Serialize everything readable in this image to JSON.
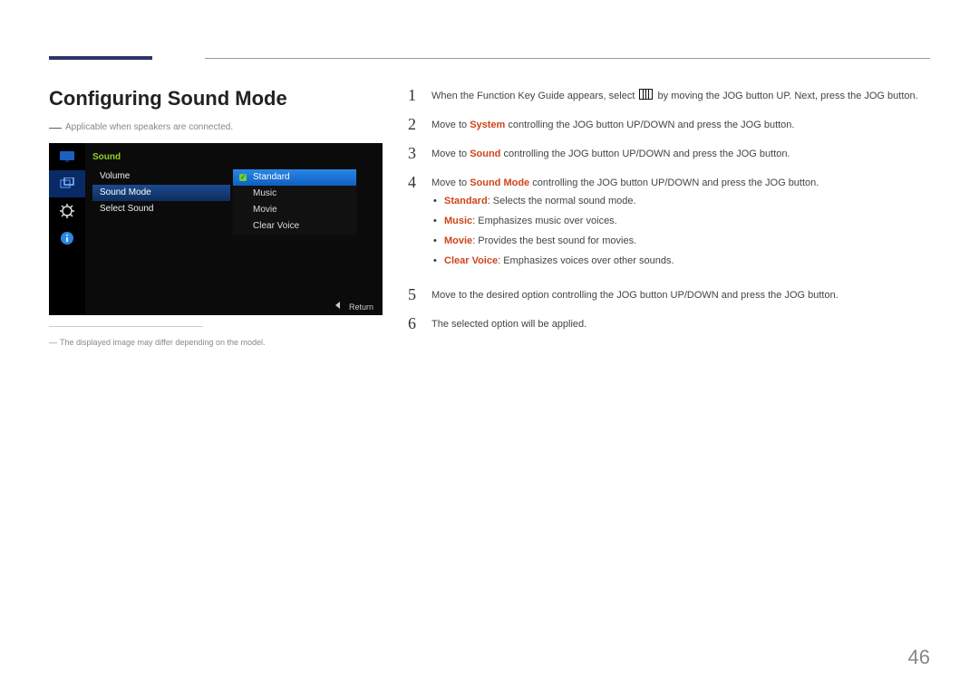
{
  "page": {
    "number": "46"
  },
  "heading": "Configuring Sound Mode",
  "subnote": "Applicable when speakers are connected.",
  "footnote": "The displayed image may differ depending on the model.",
  "osd": {
    "title": "Sound",
    "menu": [
      "Volume",
      "Sound Mode",
      "Select Sound"
    ],
    "selected_menu_index": 1,
    "submenu": [
      "Standard",
      "Music",
      "Movie",
      "Clear Voice"
    ],
    "selected_sub_index": 0,
    "return_label": "Return"
  },
  "instructions": {
    "steps": [
      {
        "n": "1",
        "pre": "When the Function Key Guide appears, select ",
        "post": " by moving the JOG button UP. Next, press the JOG button.",
        "icon": true
      },
      {
        "n": "2",
        "text_parts": [
          "Move to ",
          {
            "red": "System"
          },
          " controlling the JOG button UP/DOWN and press the JOG button."
        ]
      },
      {
        "n": "3",
        "text_parts": [
          "Move to ",
          {
            "red": "Sound"
          },
          " controlling the JOG button UP/DOWN and press the JOG button."
        ]
      },
      {
        "n": "4",
        "text_parts": [
          "Move to ",
          {
            "red": "Sound Mode"
          },
          " controlling the JOG button UP/DOWN and press the JOG button."
        ],
        "bullets": [
          {
            "label": "Standard",
            "desc": ": Selects the normal sound mode."
          },
          {
            "label": "Music",
            "desc": ": Emphasizes music over voices."
          },
          {
            "label": "Movie",
            "desc": ": Provides the best sound for movies."
          },
          {
            "label": "Clear Voice",
            "desc": ": Emphasizes voices over other sounds."
          }
        ]
      },
      {
        "n": "5",
        "plain": "Move to the desired option controlling the JOG button UP/DOWN and press the JOG button."
      },
      {
        "n": "6",
        "plain": "The selected option will be applied."
      }
    ]
  }
}
